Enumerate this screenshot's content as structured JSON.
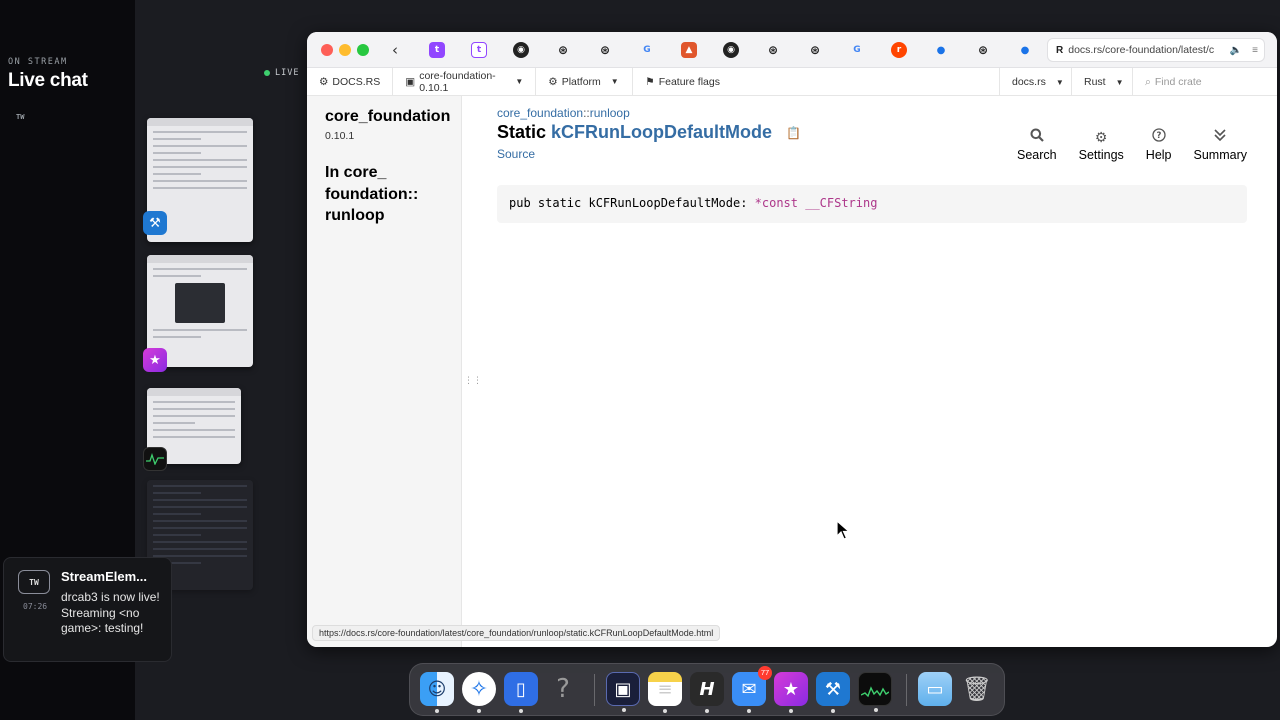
{
  "stream": {
    "on_stream_label": "ON STREAM",
    "title": "Live chat",
    "tw_label": "TW",
    "live_label": "LIVE"
  },
  "browser": {
    "back_icon": "chevron-left-icon",
    "tab_icons": [
      "twitch",
      "twitch",
      "github",
      "docs-rs",
      "docs-rs",
      "google",
      "orange-extension",
      "github",
      "docs-rs",
      "docs-rs",
      "google",
      "reddit",
      "blue-dot",
      "docs-rs",
      "blue-dot"
    ],
    "active_tab": {
      "logo": "R",
      "url": "docs.rs/core-foundation/latest/c"
    }
  },
  "docs_nav": {
    "logo_label": "DOCS.RS",
    "crate_label": "core-foundation-0.10.1",
    "platform_label": "Platform",
    "feature_flags_label": "Feature flags",
    "docsrs_label": "docs.rs",
    "rust_label": "Rust",
    "find_crate_placeholder": "Find crate"
  },
  "sidebar": {
    "crate_name": "core_foundation",
    "version": "0.10.1",
    "in_module": "In core_ foundation:: runloop"
  },
  "main": {
    "breadcrumb_crate": "core_foundation",
    "breadcrumb_sep": "::",
    "breadcrumb_module": "runloop",
    "kind": "Static",
    "name": "kCFRunLoopDefaultMode",
    "source_label": "Source",
    "toolbar": {
      "search": "Search",
      "settings": "Settings",
      "help": "Help",
      "summary": "Summary"
    },
    "code": {
      "prefix": "pub static kCFRunLoopDefaultMode: ",
      "type": "*const __CFString"
    }
  },
  "status_url": "https://docs.rs/core-foundation/latest/core_foundation/runloop/static.kCFRunLoopDefaultMode.html",
  "notification": {
    "avatar": "TW",
    "time": "07:26",
    "title": "StreamElem...",
    "body": "drcab3 is now live! Streaming <no game>: testing!"
  },
  "dock": {
    "mail_badge": "77",
    "apps": [
      "finder",
      "safari",
      "simulator",
      "help",
      "xcode-instruments",
      "notes",
      "hype",
      "mail",
      "superstar",
      "xcode-beta",
      "activity-monitor",
      "folder",
      "trash"
    ]
  },
  "colors": {
    "link": "#356da4",
    "code_type": "#ad378a",
    "live_dot": "#3ecf6e"
  }
}
